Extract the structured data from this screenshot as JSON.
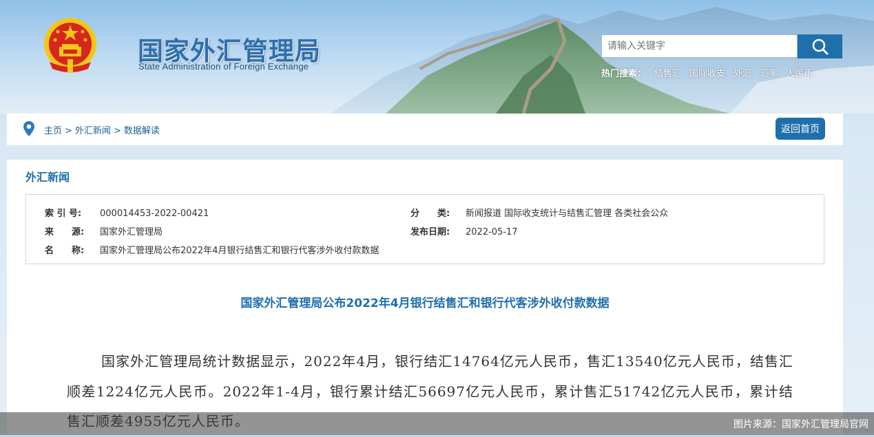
{
  "header": {
    "title_cn": "国家外汇管理局",
    "title_en": "State Administration of Foreign Exchange",
    "search": {
      "placeholder": "请输入关键字",
      "button_icon": "search-icon"
    },
    "hot_search": {
      "label": "热门搜索：",
      "items": [
        "结售汇",
        "国际收支",
        "外汇",
        "汇率",
        "人民币"
      ]
    }
  },
  "breadcrumb": {
    "items": [
      "主页",
      "外汇新闻",
      "数据解读"
    ],
    "separator": ">",
    "home_button": "返回首页"
  },
  "section": {
    "title": "外汇新闻"
  },
  "meta": {
    "index_label": "索 引 号:",
    "index_value": "000014453-2022-00421",
    "category_label": "分　　类:",
    "category_value": "新闻报道  国际收支统计与结售汇管理  各类社会公众",
    "source_label": "来　　源:",
    "source_value": "国家外汇管理局",
    "date_label": "发布日期:",
    "date_value": "2022-05-17",
    "name_label": "名　　称:",
    "name_value": "国家外汇管理局公布2022年4月银行结售汇和银行代客涉外收付款数据"
  },
  "article": {
    "title": "国家外汇管理局公布2022年4月银行结售汇和银行代客涉外收付款数据",
    "paragraph": "国家外汇管理局统计数据显示，2022年4月，银行结汇14764亿元人民币，售汇13540亿元人民币，结售汇顺差1224亿元人民币。2022年1-4月，银行累计结汇56697亿元人民币，累计售汇51742亿元人民币，累计结售汇顺差4955亿元人民币。"
  },
  "caption": "图片来源：国家外汇管理局官网",
  "colors": {
    "accent": "#1f6fad",
    "link": "#1f5f99",
    "emblem_red": "#d8251d",
    "emblem_gold": "#f5c518"
  }
}
